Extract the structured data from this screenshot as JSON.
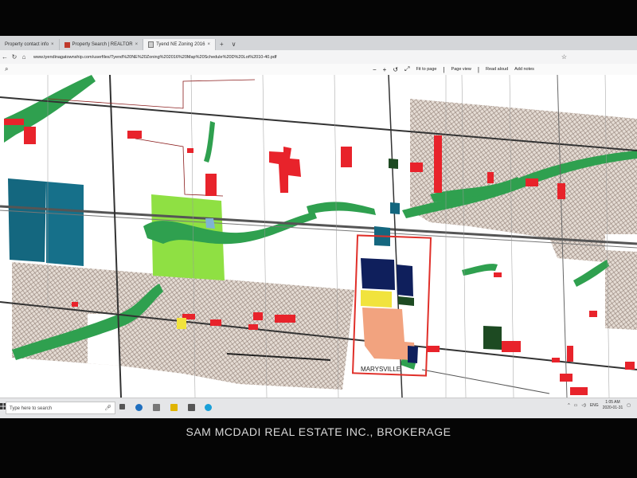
{
  "browser": {
    "tabs": [
      {
        "label": "Property contact info",
        "active": false
      },
      {
        "label": "Property Search | REALTOR",
        "active": false
      },
      {
        "label": "Tyend NE Zoning 2016",
        "active": true
      }
    ],
    "new_tab_symbol": "+",
    "tab_menu_symbol": "∨",
    "address": "www.tyendinagatownship.com/userfiles/Tyend%20NE%20Zoning%202016%20Map%20Schedule%20D%20Lot%2010-40.pdf",
    "back_icon": "back-arrow-icon",
    "refresh_icon": "refresh-icon",
    "home_icon": "home-icon",
    "favorite_icon": "star-icon"
  },
  "pdf_toolbar": {
    "zoom_out": "−",
    "zoom_in": "+",
    "fit_to_page": "Fit to page",
    "page_view": "Page view",
    "read_aloud": "Read aloud",
    "add_notes": "Add notes"
  },
  "map": {
    "town_label": "MARYSVILLE",
    "highlight_color": "#e0302a",
    "zone_colors": {
      "residential": "#e8232b",
      "hatched_rural": "#e3d8cf",
      "environmental": "#2fa04f",
      "commercial_core": "#f2a37f",
      "open_space": "#8ee042",
      "institutional": "#14677f",
      "industrial": "#0f1f5c",
      "yellow_zone": "#f1e33d",
      "dark_green": "#1d4a22"
    }
  },
  "taskbar": {
    "search_placeholder": "Type here to search",
    "language": "ENG",
    "time": "1:05 AM",
    "date": "2020-01-31"
  },
  "watermark": "SAM MCDADI REAL ESTATE INC., BROKERAGE"
}
